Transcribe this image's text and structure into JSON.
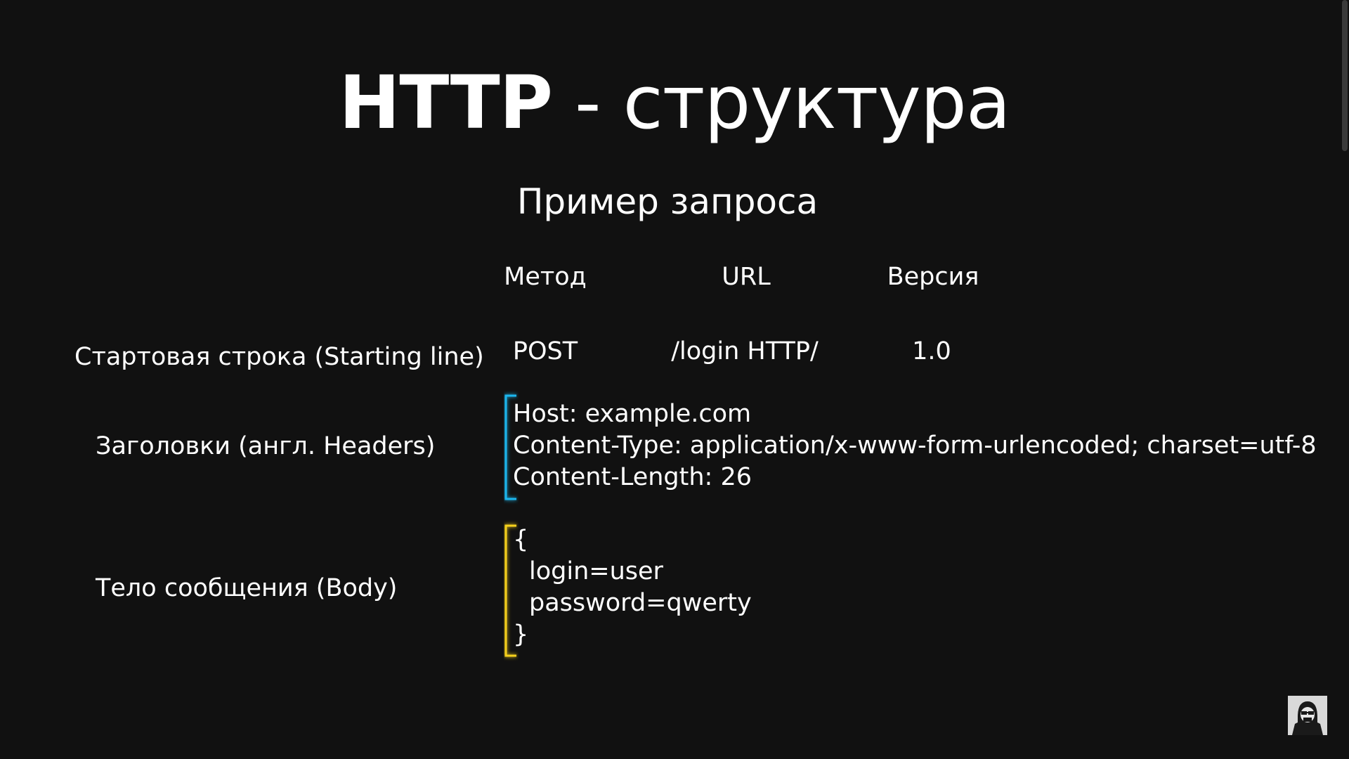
{
  "title": {
    "bold": "HTTP",
    "rest": " - структура"
  },
  "subtitle": "Пример запроса",
  "start_line": {
    "label": "Стартовая строка (Starting line)",
    "parts": {
      "method": {
        "caption": "Метод",
        "value": "POST"
      },
      "url": {
        "caption": "URL",
        "value": "/login HTTP/"
      },
      "version": {
        "caption": "Версия",
        "value": "1.0"
      }
    }
  },
  "headers": {
    "label": "Заголовки (англ. Headers)",
    "lines": [
      "Host: example.com",
      "Content-Type: application/x-www-form-urlencoded; charset=utf-8",
      "Content-Length: 26"
    ]
  },
  "body": {
    "label": "Тело сообщения (Body)",
    "lines": [
      "{",
      "login=user",
      "password=qwerty",
      "}"
    ]
  },
  "colors": {
    "background": "#111111",
    "start_line": "#e020c8",
    "method": "#8e9cff",
    "url": "#2ee84a",
    "version": "#2ee84a",
    "headers": "#1fb8f0",
    "body": "#f7d21c"
  },
  "icons": {
    "avatar": "hacker-avatar-icon"
  }
}
